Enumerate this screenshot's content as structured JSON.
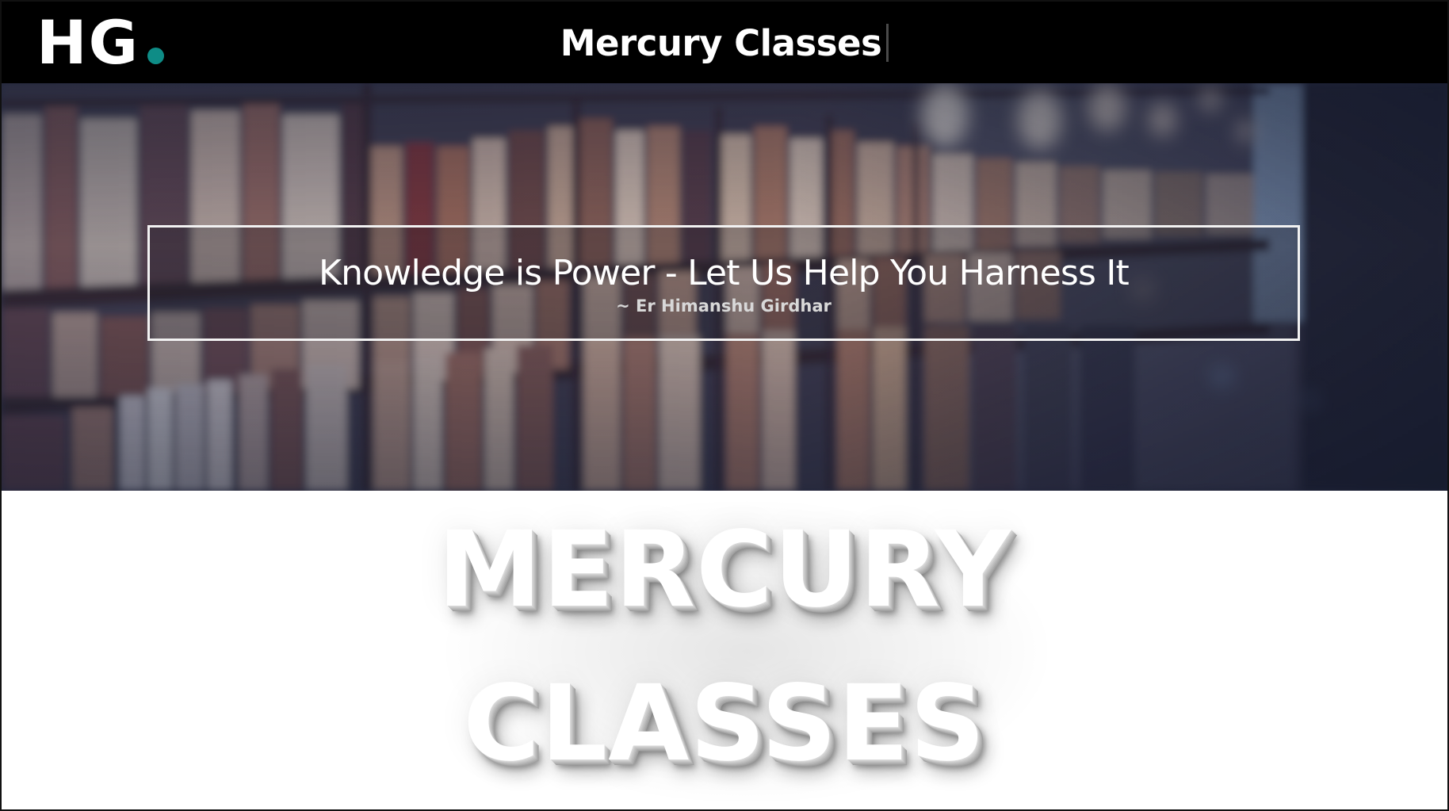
{
  "header": {
    "logo_text": "HG",
    "logo_dot_color": "#0e8c86",
    "title": "Mercury Classes"
  },
  "hero": {
    "background_image": "blurred-library-bookshelves",
    "quote": "Knowledge is Power - Let Us Help You Harness It",
    "author": "~ Er Himanshu Girdhar"
  },
  "banner": {
    "line1": "MERCURY",
    "line2": "CLASSES"
  },
  "colors": {
    "header_bg": "#000000",
    "accent": "#0e8c86",
    "text_light": "#ffffff"
  }
}
